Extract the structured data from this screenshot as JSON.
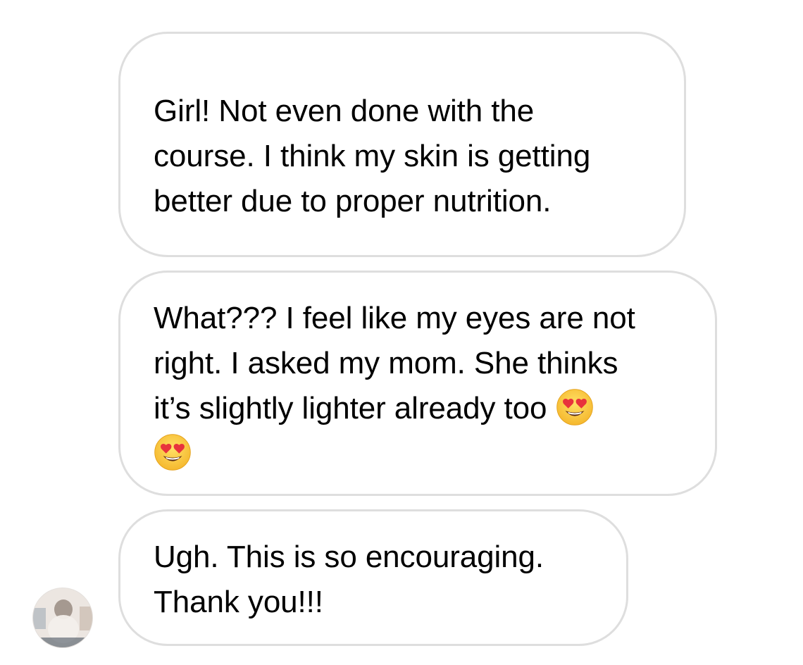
{
  "messages": [
    {
      "lines": [
        "Girl! Not even done with the",
        "course. I think my skin is getting",
        "better due to proper nutrition."
      ]
    },
    {
      "lines": [
        "What??? I feel like my eyes are not",
        "right. I asked my mom. She thinks",
        "it’s slightly lighter already too"
      ],
      "emoji": "smiling-face-with-heart-eyes"
    },
    {
      "lines": [
        "Ugh. This is so encouraging.",
        "Thank you!!!"
      ]
    }
  ],
  "colors": {
    "bubble_border": "#dedede",
    "text": "#000000",
    "background": "#ffffff"
  }
}
